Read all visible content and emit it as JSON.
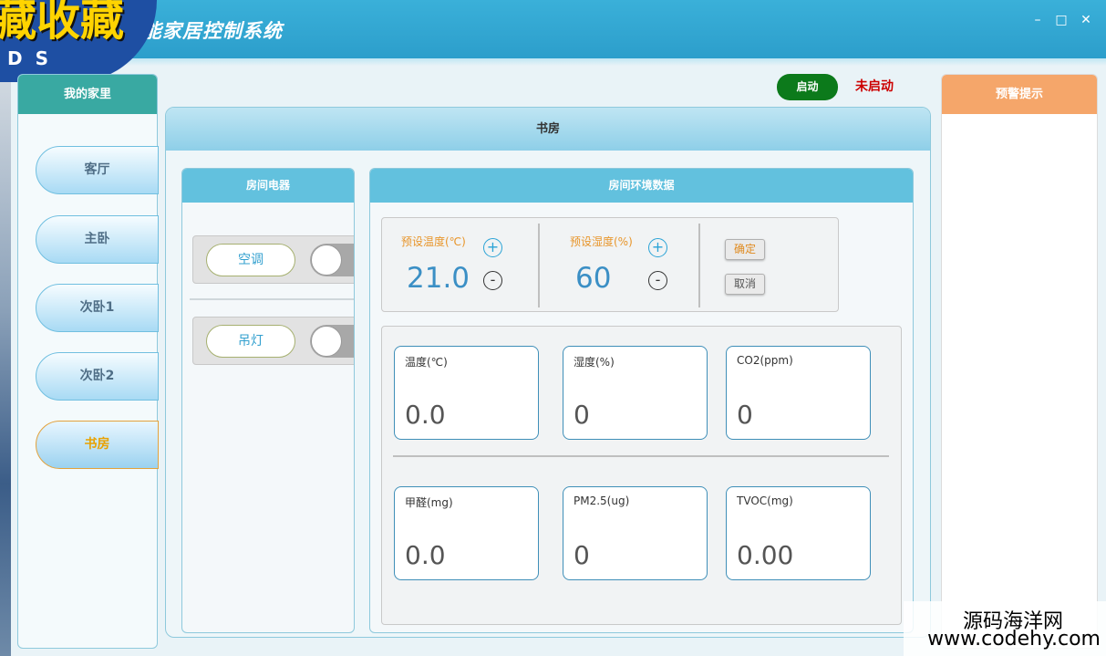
{
  "window": {
    "title": "智能家居控制系统",
    "minimize": "–",
    "maximize": "□",
    "close": "✕"
  },
  "overlay": {
    "big_text": "藏收藏",
    "small_text": "DS"
  },
  "sidebar": {
    "header": "我的家里",
    "rooms": [
      "客厅",
      "主卧",
      "次卧1",
      "次卧2",
      "书房"
    ],
    "selected_room": "书房"
  },
  "toolbar": {
    "start_label": "启动",
    "status_text": "未启动"
  },
  "main": {
    "room_title": "书房"
  },
  "devices": {
    "header": "房间电器",
    "items": [
      {
        "label": "空调",
        "on": false
      },
      {
        "label": "吊灯",
        "on": false
      }
    ]
  },
  "environment": {
    "header": "房间环境数据",
    "preset_temp_label": "预设温度(℃)",
    "preset_temp_value": "21.0",
    "preset_humidity_label": "预设湿度(%)",
    "preset_humidity_value": "60",
    "plus": "+",
    "minus": "-",
    "confirm_label": "确定",
    "cancel_label": "取消",
    "sensors": [
      {
        "label": "温度(℃)",
        "value": "0.0"
      },
      {
        "label": "湿度(%)",
        "value": "0"
      },
      {
        "label": "CO2(ppm)",
        "value": "0"
      },
      {
        "label": "甲醛(mg)",
        "value": "0.0"
      },
      {
        "label": "PM2.5(ug)",
        "value": "0"
      },
      {
        "label": "TVOC(mg)",
        "value": "0.00"
      }
    ]
  },
  "warnings": {
    "header": "预警提示"
  },
  "watermark": {
    "line1": "源码海洋网",
    "line2": "www.codehy.com"
  },
  "colors": {
    "title_bar": "#2c9ecb",
    "sidebar_header": "#39a9a2",
    "start_button": "#0c7a1b",
    "status_text": "#cc0000",
    "warning_header": "#f5a66a",
    "selected_room_text": "#e9a100"
  }
}
